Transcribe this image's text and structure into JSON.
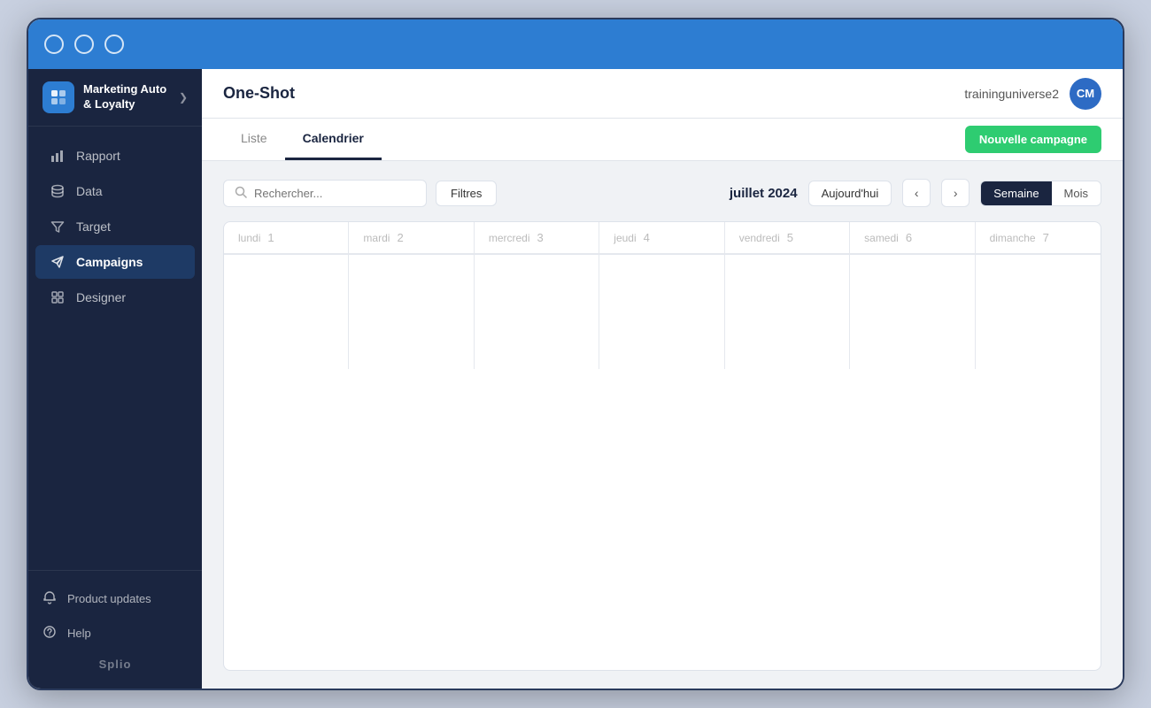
{
  "window": {
    "titlebar_buttons": [
      "close",
      "minimize",
      "maximize"
    ]
  },
  "sidebar": {
    "brand": {
      "name": "Marketing Auto & Loyalty",
      "chevron": "❯"
    },
    "nav_items": [
      {
        "id": "rapport",
        "label": "Rapport",
        "icon": "chart-bar"
      },
      {
        "id": "data",
        "label": "Data",
        "icon": "database"
      },
      {
        "id": "target",
        "label": "Target",
        "icon": "filter"
      },
      {
        "id": "campaigns",
        "label": "Campaigns",
        "icon": "paper-plane",
        "active": true
      },
      {
        "id": "designer",
        "label": "Designer",
        "icon": "design"
      }
    ],
    "bottom_items": [
      {
        "id": "product-updates",
        "label": "Product updates",
        "icon": "bell"
      },
      {
        "id": "help",
        "label": "Help",
        "icon": "help-circle"
      }
    ],
    "logo": "Splio"
  },
  "topbar": {
    "title": "One-Shot",
    "workspace": "traininguniverse2",
    "avatar_initials": "CM"
  },
  "tabs": {
    "items": [
      {
        "id": "liste",
        "label": "Liste"
      },
      {
        "id": "calendrier",
        "label": "Calendrier",
        "active": true
      }
    ],
    "new_campaign_btn": "Nouvelle campagne"
  },
  "calendar": {
    "current_month": "juillet 2024",
    "today_btn": "Aujourd'hui",
    "search_placeholder": "Rechercher...",
    "filtres_btn": "Filtres",
    "view_semaine": "Semaine",
    "view_mois": "Mois",
    "days": [
      {
        "name": "lundi",
        "num": "1"
      },
      {
        "name": "mardi",
        "num": "2"
      },
      {
        "name": "mercredi",
        "num": "3"
      },
      {
        "name": "jeudi",
        "num": "4"
      },
      {
        "name": "vendredi",
        "num": "5"
      },
      {
        "name": "samedi",
        "num": "6"
      },
      {
        "name": "dimanche",
        "num": "7"
      }
    ]
  }
}
